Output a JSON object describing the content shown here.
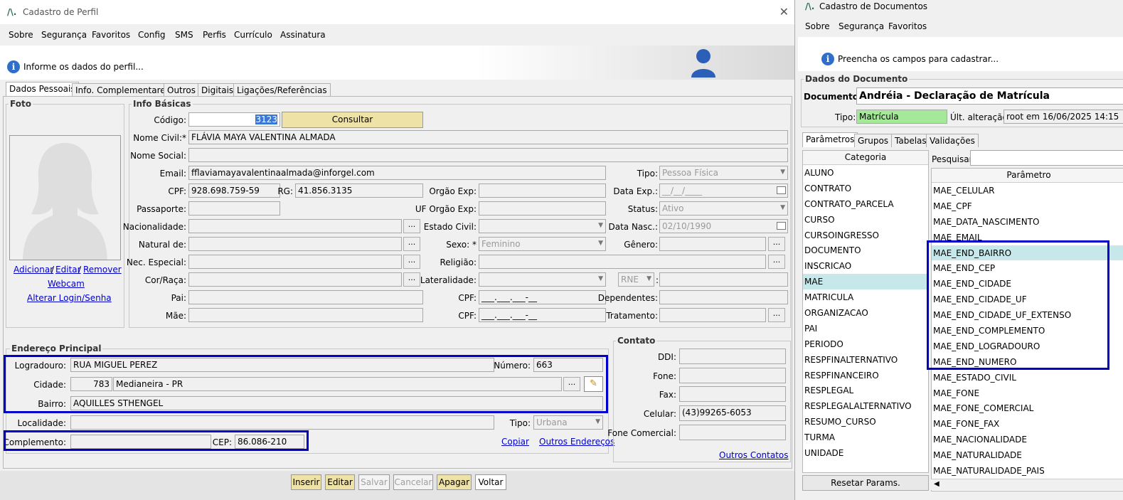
{
  "left": {
    "title": "Cadastro de Perfil",
    "menu": [
      "Sobre",
      "Segurança",
      "Favoritos",
      "Config",
      "SMS",
      "Perfis",
      "Currículo",
      "Assinatura"
    ],
    "info": "Informe os dados do perfil...",
    "tabs": [
      "Dados Pessoais",
      "Info. Complementares",
      "Outros",
      "Digitais",
      "Ligações/Referências"
    ],
    "foto": {
      "title": "Foto",
      "adicionar": "Adicionar",
      "editar": "Editar",
      "remover": "Remover",
      "sep": "/",
      "webcam": "Webcam",
      "alterar": "Alterar Login/Senha"
    },
    "basics": {
      "title": "Info Básicas",
      "codigo_l": "Código:",
      "codigo": "3123",
      "consultar": "Consultar",
      "nome_civil_l": "Nome Civil:*",
      "nome_civil": "FLÁVIA MAYA VALENTINA ALMADA",
      "nome_social_l": "Nome Social:",
      "email_l": "Email:",
      "email": "fflaviamayavalentinaalmada@inforgel.com",
      "tipo_l": "Tipo:",
      "tipo": "Pessoa Física",
      "cpf_l": "CPF:",
      "cpf": "928.698.759-59",
      "rg_l": "RG:",
      "rg": "41.856.3135",
      "orgao_l": "Orgão Exp:",
      "dataexp_l": "Data Exp.:",
      "dataexp": "__/__/____",
      "passaporte_l": "Passaporte:",
      "uforgao_l": "UF Orgão Exp:",
      "status_l": "Status:",
      "status": "Ativo",
      "nacionalidade_l": "Nacionalidade:",
      "estadocivil_l": "Estado Civil:",
      "datanasc_l": "Data Nasc.:",
      "datanasc": "02/10/1990",
      "natural_l": "Natural de:",
      "sexo_l": "Sexo: *",
      "sexo": "Feminino",
      "genero_l": "Gênero:",
      "nec_l": "Nec. Especial:",
      "religiao_l": "Religião:",
      "cor_l": "Cor/Raça:",
      "lateralidade_l": "Lateralidade:",
      "rne": "RNE",
      "colon": ":",
      "pai_l": "Pai:",
      "cpf2_l": "CPF:",
      "cpf_mask": "___.___.___-__",
      "dependentes_l": "Dependentes:",
      "mae_l": "Mãe:",
      "cpf3_l": "CPF:",
      "tratamento_l": "Tratamento:",
      "dots": "..."
    },
    "endereco": {
      "title": "Endereço Principal",
      "logradouro_l": "Logradouro:",
      "logradouro": "RUA MIGUEL PEREZ",
      "numero_l": "Número:",
      "numero": "663",
      "cidade_l": "Cidade:",
      "cidade_cod": "783",
      "cidade": "Medianeira - PR",
      "bairro_l": "Bairro:",
      "bairro": "AQUILLES STHENGEL",
      "localidade_l": "Localidade:",
      "tipo_l": "Tipo:",
      "tipo": "Urbana",
      "complemento_l": "Complemento:",
      "cep_l": "CEP:",
      "cep": "86.086-210",
      "copiar": "Copiar",
      "outros": "Outros Endereços"
    },
    "contato": {
      "title": "Contato",
      "ddi_l": "DDI:",
      "fone_l": "Fone:",
      "fax_l": "Fax:",
      "celular_l": "Celular:",
      "celular": "(43)99265-6053",
      "fonecom_l": "Fone Comercial:",
      "outros": "Outros Contatos"
    },
    "buttons": [
      "Inserir",
      "Editar",
      "Salvar",
      "Cancelar",
      "Apagar",
      "Voltar"
    ]
  },
  "right": {
    "title": "Cadastro de Documentos",
    "menu": [
      "Sobre",
      "Segurança",
      "Favoritos"
    ],
    "info": "Preencha os campos para cadastrar...",
    "dados_title": "Dados do Documento",
    "documento_l": "Documento:",
    "documento": "Andréia - Declaração de Matrícula",
    "tipo_l": "Tipo:",
    "tipo": "Matrícula",
    "ult_l": "Últ. alteração:",
    "ult": "root em 16/06/2025 14:15",
    "tabs": [
      "Parâmetros",
      "Grupos",
      "Tabelas",
      "Validações"
    ],
    "categoria_h": "Categoria",
    "categorias": [
      "ALUNO",
      "CONTRATO",
      "CONTRATO_PARCELA",
      "CURSO",
      "CURSOINGRESSO",
      "DOCUMENTO",
      "INSCRICAO",
      "MAE",
      "MATRICULA",
      "ORGANIZACAO",
      "PAI",
      "PERIODO",
      "RESPFINALTERNATIVO",
      "RESPFINANCEIRO",
      "RESPLEGAL",
      "RESPLEGALALTERNATIVO",
      "RESUMO_CURSO",
      "TURMA",
      "UNIDADE"
    ],
    "pesquisar_l": "Pesquisar:",
    "parametro_h": "Parâmetro",
    "parametros": [
      "MAE_CELULAR",
      "MAE_CPF",
      "MAE_DATA_NASCIMENTO",
      "MAE_EMAIL",
      "MAE_END_BAIRRO",
      "MAE_END_CEP",
      "MAE_END_CIDADE",
      "MAE_END_CIDADE_UF",
      "MAE_END_CIDADE_UF_EXTENSO",
      "MAE_END_COMPLEMENTO",
      "MAE_END_LOGRADOURO",
      "MAE_END_NUMERO",
      "MAE_ESTADO_CIVIL",
      "MAE_FONE",
      "MAE_FONE_COMERCIAL",
      "MAE_FONE_FAX",
      "MAE_NACIONALIDADE",
      "MAE_NATURALIDADE",
      "MAE_NATURALIDADE_PAIS"
    ],
    "resetar": "Resetar Params."
  }
}
